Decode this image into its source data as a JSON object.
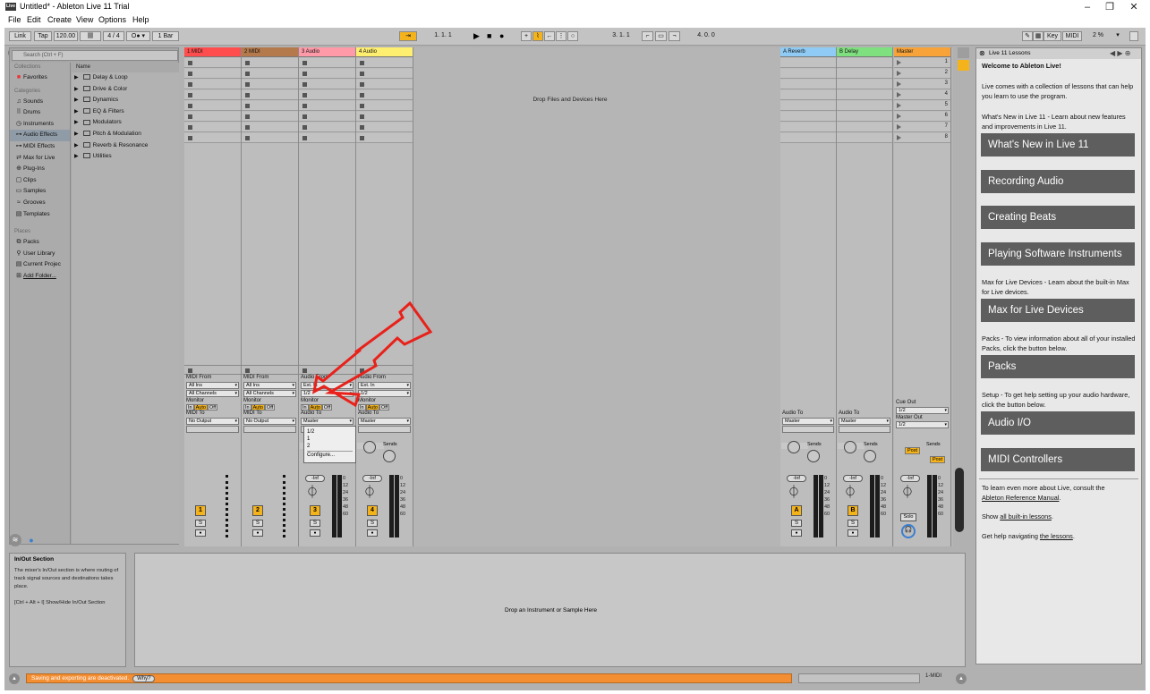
{
  "window": {
    "title": "Untitled* - Ableton Live 11 Trial",
    "logo": "Live"
  },
  "menu": [
    "File",
    "Edit",
    "Create",
    "View",
    "Options",
    "Help"
  ],
  "control_bar": {
    "link": "Link",
    "tap": "Tap",
    "tempo": "120.00",
    "meter": "4 / 4",
    "quantize": "1 Bar",
    "position": "1.   1.   1",
    "loop_start": "3.   1.   1",
    "loop_length": "4.   0.   0",
    "key": "Key",
    "midi": "MIDI",
    "cpu": "2 %"
  },
  "browser": {
    "search_placeholder": "Search (Ctrl + F)",
    "collections_header": "Collections",
    "favorites": "Favorites",
    "categories_header": "Categories",
    "categories": [
      "Sounds",
      "Drums",
      "Instruments",
      "Audio Effects",
      "MIDI Effects",
      "Max for Live",
      "Plug-Ins",
      "Clips",
      "Samples",
      "Grooves",
      "Templates"
    ],
    "category_icons": [
      "♫",
      "⠿",
      "◷",
      "⊶",
      "⊶",
      "⇄",
      "⊕",
      "▢",
      "▭",
      "≈",
      "▤"
    ],
    "selected_category": "Audio Effects",
    "places_header": "Places",
    "places": [
      "Packs",
      "User Library",
      "Current Projec",
      "Add Folder..."
    ],
    "name_header": "Name",
    "folders": [
      "Delay & Loop",
      "Drive & Color",
      "Dynamics",
      "EQ & Filters",
      "Modulators",
      "Pitch & Modulation",
      "Reverb & Resonance",
      "Utilities"
    ]
  },
  "tracks": [
    {
      "name": "1 MIDI",
      "color": "#ff4d4d",
      "io_header": "MIDI From",
      "input": "All Ins",
      "channel": "All Channels",
      "out_header": "MIDI To",
      "output": "No Output",
      "number": "1"
    },
    {
      "name": "2 MIDI",
      "color": "#b57a4c",
      "io_header": "MIDI From",
      "input": "All Ins",
      "channel": "All Channels",
      "out_header": "MIDI To",
      "output": "No Output",
      "number": "2"
    },
    {
      "name": "3 Audio",
      "color": "#ff9aa8",
      "io_header": "Audio From",
      "input": "Ext. In",
      "channel": "1/2",
      "out_header": "Audio To",
      "output": "Master",
      "number": "3"
    },
    {
      "name": "4 Audio",
      "color": "#ffef71",
      "io_header": "Audio From",
      "input": "Ext. In",
      "channel": "1/2",
      "out_header": "Audio To",
      "output": "Master",
      "number": "4"
    }
  ],
  "returns": [
    {
      "name": "A Reverb",
      "color": "#8fcbf5",
      "out_header": "Audio To",
      "output": "Master",
      "letter": "A"
    },
    {
      "name": "B Delay",
      "color": "#7fe07f",
      "out_header": "Audio To",
      "output": "Master",
      "letter": "B"
    }
  ],
  "master": {
    "name": "Master",
    "color": "#f7a33a",
    "cue_header": "Cue Out",
    "cue": "1/2",
    "out_header": "Master Out",
    "output": "1/2",
    "solo": "Solo",
    "post": "Post"
  },
  "scene_numbers": [
    "1",
    "2",
    "3",
    "4",
    "5",
    "6",
    "7",
    "8"
  ],
  "labels": {
    "monitor": "Monitor",
    "in": "In",
    "auto": "Auto",
    "off": "Off",
    "sends": "Sends",
    "inf": "-Inf",
    "s": "S",
    "db": [
      "0",
      "12",
      "24",
      "36",
      "48",
      "60"
    ]
  },
  "dropdown": [
    "1/2",
    "1",
    "2",
    "Configure..."
  ],
  "drop_files": "Drop Files and Devices Here",
  "drop_instrument": "Drop an Instrument or Sample Here",
  "info": {
    "title": "In/Out Section",
    "body": "The mixer's In/Out section is where routing of track signal sources and destinations takes place.",
    "shortcut": "[Ctrl + Alt + I] Show/Hide In/Out Section"
  },
  "lessons": {
    "header": "Live 11 Lessons",
    "welcome": "Welcome to Ableton Live!",
    "intro": "Live comes with a collection of lessons that can help you learn to use the program.",
    "whats_new_text": "What's New in Live 11 - Learn about new features and improvements in Live 11.",
    "buttons": [
      "What's New in Live 11",
      "Recording Audio",
      "Creating Beats",
      "Playing Software Instruments",
      "Max for Live Devices",
      "Packs",
      "Audio I/O",
      "MIDI Controllers"
    ],
    "max_text": "Max for Live Devices - Learn about the built-in Max for Live devices.",
    "packs_text": "Packs - To view information about all of your installed Packs, click the button below.",
    "setup_text": "Setup - To get help setting up your audio hardware, click the button below.",
    "footer1": "To learn even more about Live, consult the",
    "footer_link": "Ableton Reference Manual",
    "footer2": "Show",
    "footer2_link": "all built-in lessons",
    "footer3": "Get help navigating",
    "footer3_link": "the lessons"
  },
  "status": {
    "message": "Saving and exporting are deactivated.",
    "why": "Why?",
    "midi": "1-MIDI"
  },
  "annotation_color": "#e8211a"
}
